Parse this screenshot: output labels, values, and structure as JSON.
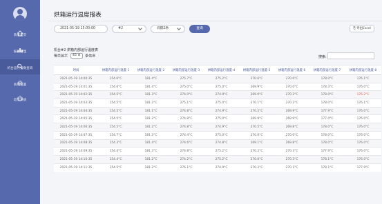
{
  "sidebar": {
    "items": [
      {
        "label": "系统首页",
        "icon": "home-icon"
      },
      {
        "label": "报表管理",
        "icon": "bar-chart-icon"
      },
      {
        "label": "机台运行参数查询",
        "icon": "search-icon"
      },
      {
        "label": "系统设置",
        "icon": "gear-icon"
      },
      {
        "label": "退出系统",
        "icon": "power-icon"
      }
    ],
    "active_index": 2,
    "colors": {
      "background": "#5769ad",
      "active": "#4a5b9c"
    }
  },
  "page": {
    "title": "烘箱运行温度报表"
  },
  "filters": {
    "datetime": "2021-05-19 15:00:00",
    "machine": "#2",
    "interval": "间隔1秒",
    "query_label": "查询",
    "export_label": "导出Excel"
  },
  "table": {
    "title": "机台#2 烘箱内部运行温度表",
    "page_size_prefix": "每页显示",
    "page_size": "45",
    "page_size_suffix": "条信息",
    "search_label": "搜索:",
    "search_value": "",
    "headers": [
      "时间",
      "烘箱内部运行温度-1",
      "烘箱内部运行温度-2",
      "烘箱内部运行温度-3",
      "烘箱内部运行温度-4",
      "烘箱内部运行温度-5",
      "烘箱内部运行温度-6",
      "烘箱内部运行温度-7",
      "烘箱内部运行温度-8"
    ],
    "rows": [
      [
        "2021-05-19 14:00:35",
        "154.6°C",
        "181.4°C",
        "275.7°C",
        "275.2°C",
        "270.6°C",
        "270.0°C",
        "178.0°C",
        "176.1°C"
      ],
      [
        "2021-05-19 14:01:35",
        "154.6°C",
        "181.4°C",
        "275.0°C",
        "275.0°C",
        "269.9°C",
        "270.0°C",
        "178.3°C",
        "176.0°C"
      ],
      [
        "2021-05-19 14:02:35",
        "154.5°C",
        "181.3°C",
        "274.0°C",
        "274.9°C",
        "269.0°C",
        "270.2°C",
        "178.0°C",
        "176.2°C"
      ],
      [
        "2021-05-19 14:03:35",
        "154.5°C",
        "181.2°C",
        "275.1°C",
        "275.0°C",
        "270.1°C",
        "270.2°C",
        "178.0°C",
        "176.1°C"
      ],
      [
        "2021-05-19 14:04:35",
        "154.5°C",
        "181.1°C",
        "274.8°C",
        "274.9°C",
        "270.2°C",
        "269.9°C",
        "177.9°C",
        "176.0°C"
      ],
      [
        "2021-05-19 14:05:35",
        "154.5°C",
        "181.2°C",
        "274.8°C",
        "275.0°C",
        "269.9°C",
        "269.9°C",
        "177.0°C",
        "176.0°C"
      ],
      [
        "2021-05-19 14:06:35",
        "154.5°C",
        "181.2°C",
        "274.8°C",
        "274.9°C",
        "270.5°C",
        "269.8°C",
        "178.0°C",
        "176.0°C"
      ],
      [
        "2021-05-19 14:07:35",
        "154.7°C",
        "181.3°C",
        "274.4°C",
        "275.0°C",
        "270.0°C",
        "270.0°C",
        "178.0°C",
        "176.0°C"
      ],
      [
        "2021-05-19 14:08:35",
        "154.3°C",
        "181.4°C",
        "274.6°C",
        "274.8°C",
        "269.1°C",
        "269.8°C",
        "178.0°C",
        "176.0°C"
      ],
      [
        "2021-05-19 14:09:35",
        "154.4°C",
        "181.3°C",
        "274.8°C",
        "275.2°C",
        "270.2°C",
        "270.3°C",
        "177.9°C",
        "176.0°C"
      ],
      [
        "2021-05-19 14:10:35",
        "154.4°C",
        "181.2°C",
        "274.2°C",
        "275.2°C",
        "270.0°C",
        "270.3°C",
        "178.1°C",
        "176.0°C"
      ],
      [
        "2021-05-19 14:11:35",
        "154.5°C",
        "181.2°C",
        "276.1°C",
        "274.9°C",
        "270.2°C",
        "270.1°C",
        "178.1°C",
        "177.9°C"
      ]
    ],
    "highlight": {
      "row": 2,
      "col": 8,
      "color": "#e5534b"
    }
  }
}
